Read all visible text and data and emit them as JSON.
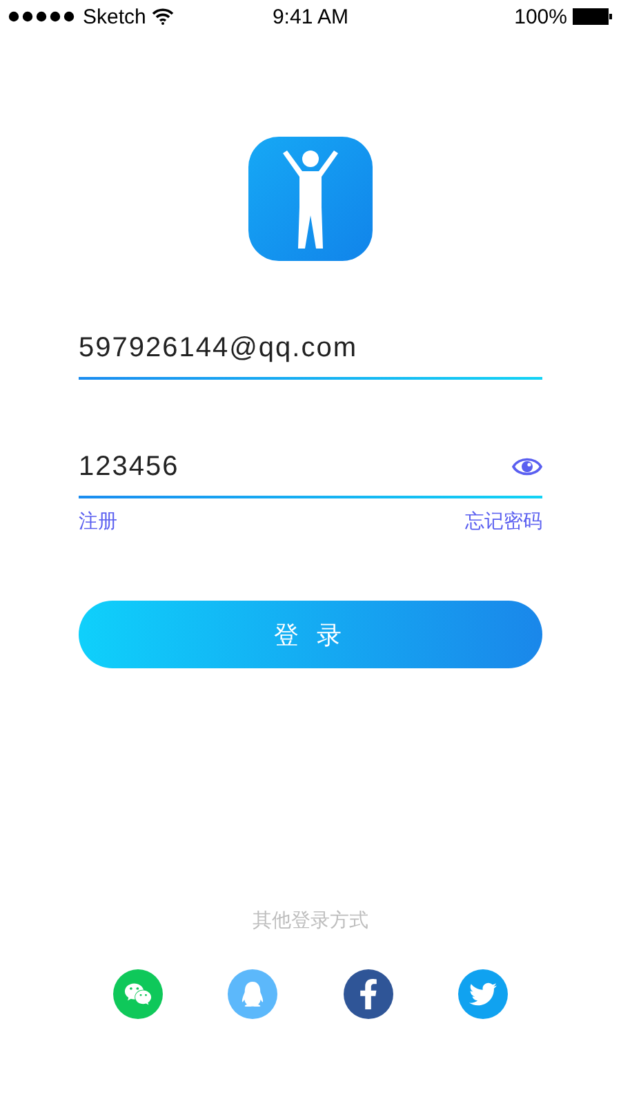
{
  "status_bar": {
    "carrier": "Sketch",
    "time": "9:41 AM",
    "battery": "100%"
  },
  "email": {
    "value": "597926144@qq.com"
  },
  "password": {
    "value": "123456"
  },
  "links": [
    "注册",
    "忘记密码"
  ],
  "login_button": "登 录",
  "other_login": {
    "label": "其他登录方式",
    "providers": [
      {
        "kind": "wechat",
        "color": "#0fc85a"
      },
      {
        "kind": "qq",
        "color": "#5cb8fb"
      },
      {
        "kind": "facebook",
        "color": "#2f5597"
      },
      {
        "kind": "twitter",
        "color": "#10a2f0"
      }
    ]
  }
}
